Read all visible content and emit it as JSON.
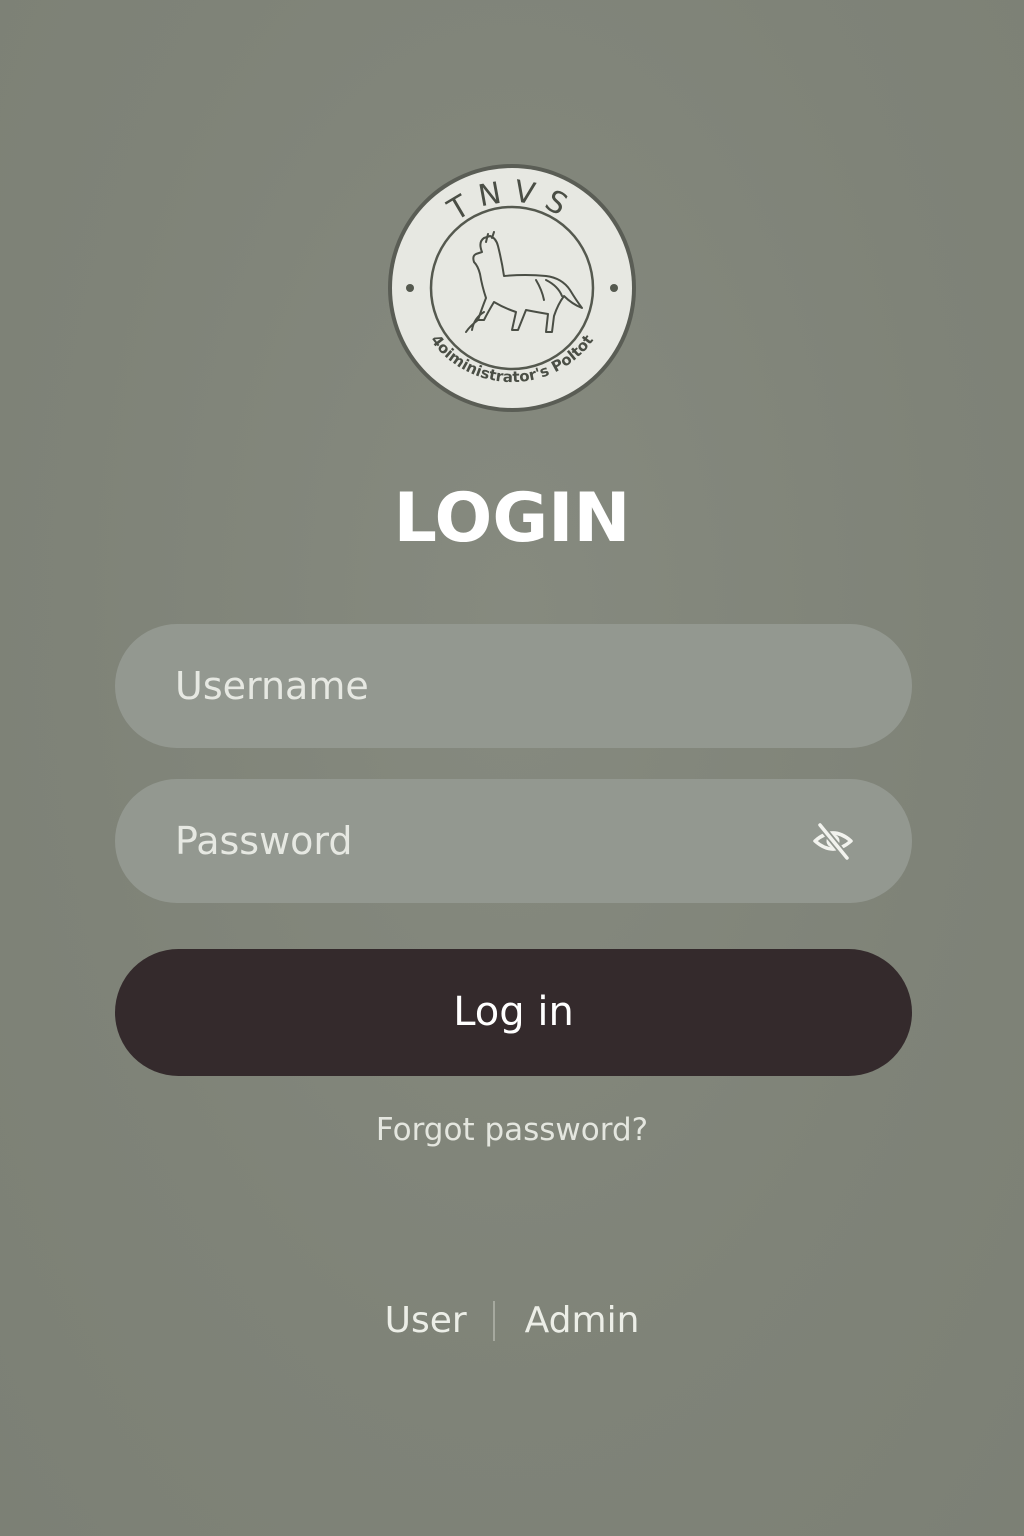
{
  "logo": {
    "top_text": "TNVS",
    "bottom_text": "4oiministrator's Poltot",
    "emblem": "horse-icon"
  },
  "title": "LOGIN",
  "username": {
    "placeholder": "Username",
    "value": ""
  },
  "password": {
    "placeholder": "Password",
    "value": "",
    "toggle_icon": "eye-slash-icon"
  },
  "login_button": {
    "label": "Log in"
  },
  "forgot_link": "Forgot password?",
  "role_switch": {
    "user_label": "User",
    "admin_label": "Admin"
  },
  "colors": {
    "background": "#808378",
    "field": "#939890",
    "button": "#342a2c",
    "text": "#ffffff"
  }
}
